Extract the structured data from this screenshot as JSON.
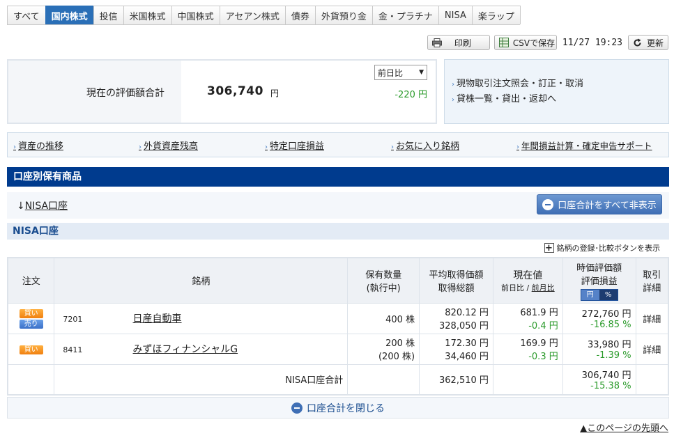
{
  "tabs": [
    "すべて",
    "国内株式",
    "投信",
    "米国株式",
    "中国株式",
    "アセアン株式",
    "債券",
    "外貨預り金",
    "金・プラチナ",
    "NISA",
    "楽ラップ"
  ],
  "toolbar": {
    "print": "印刷",
    "csv": "CSVで保存",
    "timestamp": "11/27 19:23",
    "refresh": "更新"
  },
  "summary": {
    "label": "現在の評価額合計",
    "value": "306,740",
    "unit": "円",
    "compare_select": "前日比",
    "diff": "-220 円"
  },
  "side_links": [
    "現物取引注文照会・訂正・取消",
    "貸株一覧・貸出・返却へ"
  ],
  "link_bar": [
    "資産の推移",
    "外貨資産残高",
    "特定口座損益",
    "お気に入り銘柄",
    "年間損益計算・確定申告サポート"
  ],
  "section_title": "口座別保有商品",
  "anchor_link": "NISA口座",
  "hide_all_button": "口座合計をすべて非表示",
  "account_header": "NISA口座",
  "compare_note": "銘柄の登録･比較ボタンを表示",
  "table": {
    "headers": {
      "order": "注文",
      "name": "銘柄",
      "qty": [
        "保有数量",
        "(執行中)"
      ],
      "avg": [
        "平均取得価額",
        "取得総額"
      ],
      "price": "現在値",
      "price_sub_a": "前日比",
      "price_sub_sep": " / ",
      "price_sub_b": "前月比",
      "eval": [
        "時価評価額",
        "評価損益"
      ],
      "yen": "円",
      "pct": "%",
      "detail": [
        "取引",
        "詳細"
      ]
    },
    "rows": [
      {
        "buy": "買い",
        "sell": "売り",
        "code": "7201",
        "name": "日産自動車",
        "qty": "400 株",
        "qty_pending": "",
        "avg": "820.12 円",
        "total": "328,050 円",
        "price": "681.9 円",
        "change": "-0.4 円",
        "eval": "272,760 円",
        "pl": "-16.85 %",
        "detail": "詳細"
      },
      {
        "buy": "買い",
        "sell": "",
        "code": "8411",
        "name": "みずほフィナンシャルG",
        "qty": "200 株",
        "qty_pending": "(200 株)",
        "avg": "172.30 円",
        "total": "34,460 円",
        "price": "169.9 円",
        "change": "-0.3 円",
        "eval": "33,980 円",
        "pl": "-1.39 %",
        "detail": "詳細"
      }
    ],
    "total": {
      "label": "NISA口座合計",
      "total": "362,510 円",
      "eval": "306,740 円",
      "pl": "-15.38 %"
    }
  },
  "close_button": "口座合計を閉じる",
  "page_top": "▲このページの先頭へ"
}
